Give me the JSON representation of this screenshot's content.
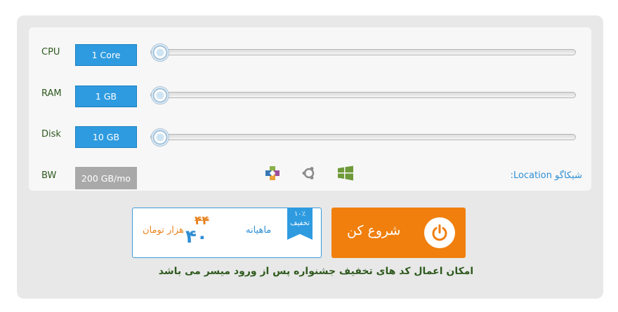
{
  "resources": [
    {
      "name": "CPU",
      "value": "1 Core",
      "level": 0
    },
    {
      "name": "RAM",
      "value": "1 GB",
      "level": 0
    },
    {
      "name": "Disk",
      "value": "10 GB",
      "level": 0
    }
  ],
  "bandwidth": {
    "name": "BW",
    "value": "200 GB/mo"
  },
  "os_icons": [
    "centos-icon",
    "ubuntu-icon",
    "windows-icon"
  ],
  "location": {
    "label": "Location:",
    "value": "شیکاگو"
  },
  "pricing": {
    "discount_badge": "۱۰٪",
    "discount_label": "تخفیف",
    "period": "ماهیانه",
    "old_price": "۴۴",
    "new_price": "۴۰",
    "unit": "هزار تومان"
  },
  "start_button": {
    "label": "شروع کن"
  },
  "footnote": "امکان اعمال کد های تخفیف جشنواره پس از ورود میسر می باشد",
  "colors": {
    "accent_blue": "#2e9be0",
    "accent_orange": "#f07f0d",
    "text_green": "#2f5a1f"
  }
}
